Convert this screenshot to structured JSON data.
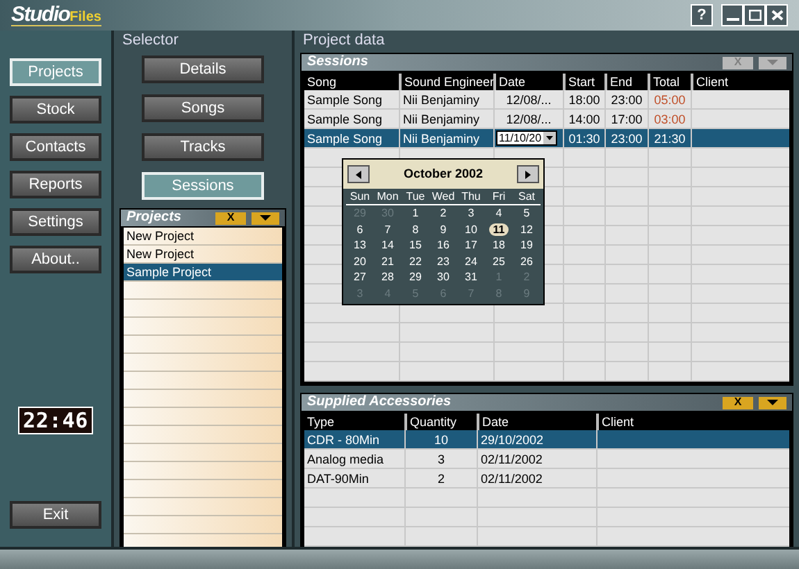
{
  "window": {
    "logo_main": "Studio",
    "logo_accent": "Files",
    "help": "?"
  },
  "nav": [
    {
      "label": "Projects",
      "selected": true
    },
    {
      "label": "Stock",
      "selected": false
    },
    {
      "label": "Contacts",
      "selected": false
    },
    {
      "label": "Reports",
      "selected": false
    },
    {
      "label": "Settings",
      "selected": false
    },
    {
      "label": "About..",
      "selected": false
    }
  ],
  "clock": "22:46",
  "exit": "Exit",
  "selector": {
    "title": "Selector",
    "items": [
      {
        "label": "Details",
        "selected": false
      },
      {
        "label": "Songs",
        "selected": false
      },
      {
        "label": "Tracks",
        "selected": false
      },
      {
        "label": "Sessions",
        "selected": true
      }
    ]
  },
  "projects": {
    "title": "Projects",
    "close": "X",
    "disabled": false,
    "items": [
      {
        "label": "New Project",
        "selected": false
      },
      {
        "label": "New Project",
        "selected": false
      },
      {
        "label": "Sample Project",
        "selected": true
      }
    ]
  },
  "project_data": {
    "title": "Project data"
  },
  "sessions": {
    "title": "Sessions",
    "close": "X",
    "disabled": true,
    "columns": [
      "Song",
      "Sound Engineer",
      "Date",
      "Start",
      "End",
      "Total",
      "Client"
    ],
    "rows": [
      {
        "selected": false,
        "editing": false,
        "cells": [
          "Sample Song",
          "Nii Benjaminy",
          "12/08/...",
          "18:00",
          "23:00",
          "05:00"
        ]
      },
      {
        "selected": false,
        "editing": false,
        "cells": [
          "Sample Song",
          "Nii Benjaminy",
          "12/08/...",
          "14:00",
          "17:00",
          "03:00"
        ]
      },
      {
        "selected": true,
        "editing": true,
        "cells": [
          "Sample Song",
          "Nii Benjaminy",
          "11/10/20",
          "01:30",
          "23:00",
          "21:30"
        ]
      }
    ]
  },
  "calendar": {
    "month": "October 2002",
    "weekdays": [
      "Sun",
      "Mon",
      "Tue",
      "Wed",
      "Thu",
      "Fri",
      "Sat"
    ],
    "days": [
      {
        "label": "29",
        "other_month": true,
        "selected": false
      },
      {
        "label": "30",
        "other_month": true,
        "selected": false
      },
      {
        "label": "1",
        "other_month": false,
        "selected": false
      },
      {
        "label": "2",
        "other_month": false,
        "selected": false
      },
      {
        "label": "3",
        "other_month": false,
        "selected": false
      },
      {
        "label": "4",
        "other_month": false,
        "selected": false
      },
      {
        "label": "5",
        "other_month": false,
        "selected": false
      },
      {
        "label": "6",
        "other_month": false,
        "selected": false
      },
      {
        "label": "7",
        "other_month": false,
        "selected": false
      },
      {
        "label": "8",
        "other_month": false,
        "selected": false
      },
      {
        "label": "9",
        "other_month": false,
        "selected": false
      },
      {
        "label": "10",
        "other_month": false,
        "selected": false
      },
      {
        "label": "11",
        "other_month": false,
        "selected": true
      },
      {
        "label": "12",
        "other_month": false,
        "selected": false
      },
      {
        "label": "13",
        "other_month": false,
        "selected": false
      },
      {
        "label": "14",
        "other_month": false,
        "selected": false
      },
      {
        "label": "15",
        "other_month": false,
        "selected": false
      },
      {
        "label": "16",
        "other_month": false,
        "selected": false
      },
      {
        "label": "17",
        "other_month": false,
        "selected": false
      },
      {
        "label": "18",
        "other_month": false,
        "selected": false
      },
      {
        "label": "19",
        "other_month": false,
        "selected": false
      },
      {
        "label": "20",
        "other_month": false,
        "selected": false
      },
      {
        "label": "21",
        "other_month": false,
        "selected": false
      },
      {
        "label": "22",
        "other_month": false,
        "selected": false
      },
      {
        "label": "23",
        "other_month": false,
        "selected": false
      },
      {
        "label": "24",
        "other_month": false,
        "selected": false
      },
      {
        "label": "25",
        "other_month": false,
        "selected": false
      },
      {
        "label": "26",
        "other_month": false,
        "selected": false
      },
      {
        "label": "27",
        "other_month": false,
        "selected": false
      },
      {
        "label": "28",
        "other_month": false,
        "selected": false
      },
      {
        "label": "29",
        "other_month": false,
        "selected": false
      },
      {
        "label": "30",
        "other_month": false,
        "selected": false
      },
      {
        "label": "31",
        "other_month": false,
        "selected": false
      },
      {
        "label": "1",
        "other_month": true,
        "selected": false
      },
      {
        "label": "2",
        "other_month": true,
        "selected": false
      },
      {
        "label": "3",
        "other_month": true,
        "selected": false
      },
      {
        "label": "4",
        "other_month": true,
        "selected": false
      },
      {
        "label": "5",
        "other_month": true,
        "selected": false
      },
      {
        "label": "6",
        "other_month": true,
        "selected": false
      },
      {
        "label": "7",
        "other_month": true,
        "selected": false
      },
      {
        "label": "8",
        "other_month": true,
        "selected": false
      },
      {
        "label": "9",
        "other_month": true,
        "selected": false
      }
    ]
  },
  "accessories": {
    "title": "Supplied Accessories",
    "close": "X",
    "disabled": false,
    "columns": [
      "Type",
      "Quantity",
      "Date",
      "Client"
    ],
    "rows": [
      {
        "selected": true,
        "cells": [
          "CDR - 80Min",
          "10",
          "29/10/2002"
        ]
      },
      {
        "selected": false,
        "cells": [
          "Analog media",
          "3",
          "02/11/2002"
        ]
      },
      {
        "selected": false,
        "cells": [
          "DAT-90Min",
          "2",
          "02/11/2002"
        ]
      }
    ]
  }
}
